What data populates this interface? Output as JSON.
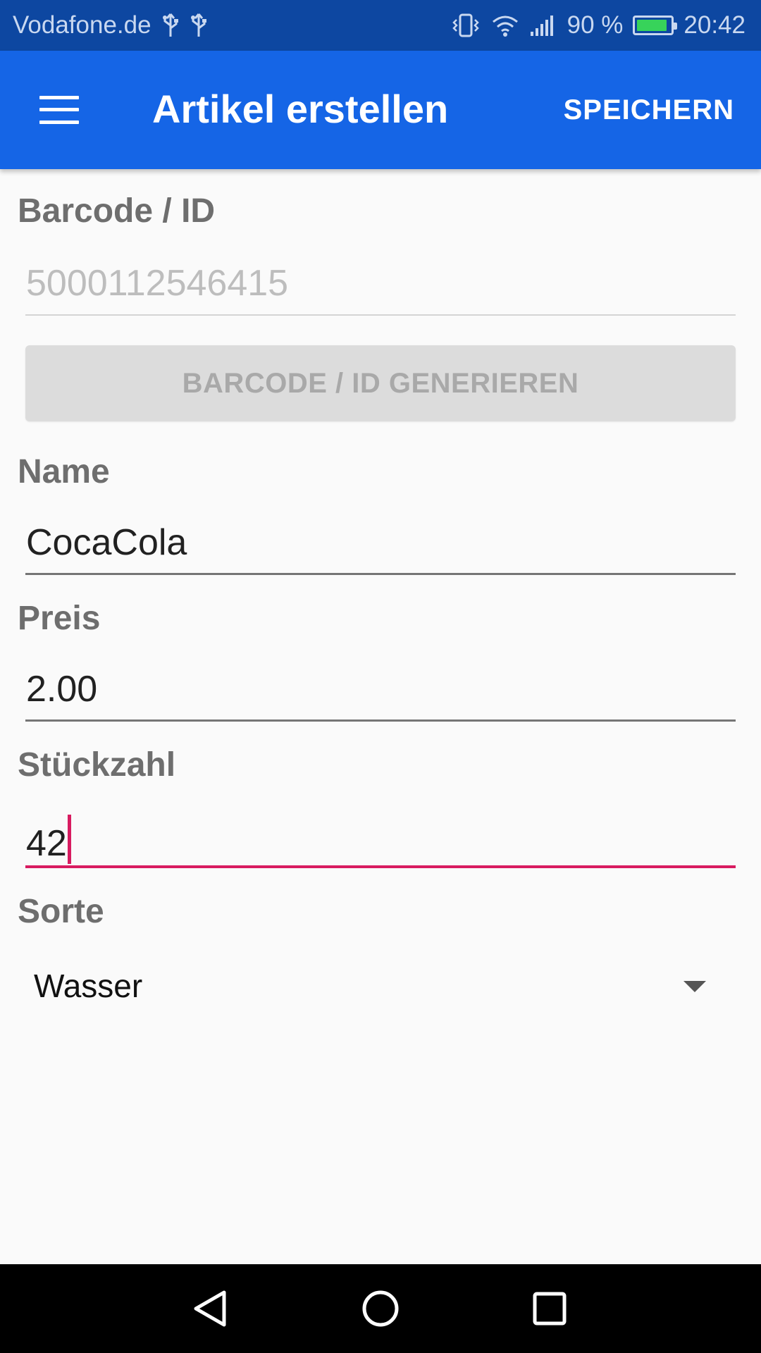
{
  "status_bar": {
    "carrier": "Vodafone.de",
    "battery_text": "90 %",
    "time": "20:42",
    "battery_color": "#37d35a",
    "battery_level": 0.9
  },
  "app_bar": {
    "title": "Artikel erstellen",
    "save_label": "SPEICHERN",
    "background": "#1565e6"
  },
  "form": {
    "barcode_label": "Barcode / ID",
    "barcode_value": "5000112546415",
    "generate_label": "BARCODE / ID GENERIEREN",
    "name_label": "Name",
    "name_value": "CocaCola",
    "price_label": "Preis",
    "price_value": "2.00",
    "quantity_label": "Stückzahl",
    "quantity_value": "42",
    "kind_label": "Sorte",
    "kind_value": "Wasser",
    "focus_color": "#d81b60"
  },
  "nav_bar": {
    "icons": [
      "back-icon",
      "home-icon",
      "recents-icon"
    ]
  }
}
